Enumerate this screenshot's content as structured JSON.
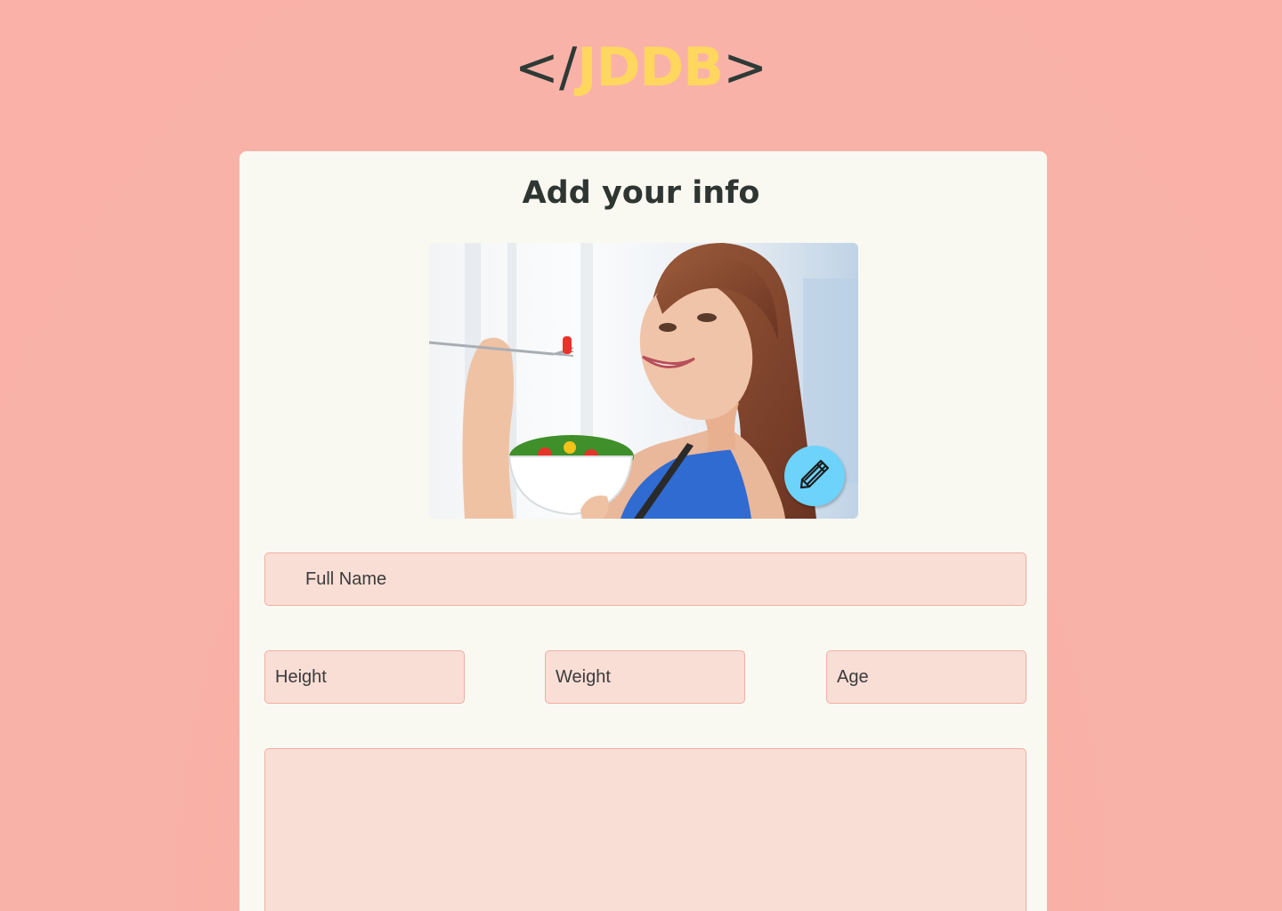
{
  "logo": {
    "open_bracket": "</",
    "brand": "JDDB",
    "close_bracket": ">",
    "colors": {
      "bracket": "#2e3a36",
      "brand": "#ffd75e"
    }
  },
  "form": {
    "title": "Add your info",
    "photo_alt": "Woman eating a salad",
    "edit_icon": "pencil-icon",
    "full_name": {
      "placeholder": "Full Name",
      "value": ""
    },
    "height": {
      "placeholder": "Height",
      "value": ""
    },
    "weight": {
      "placeholder": "Weight",
      "value": ""
    },
    "age": {
      "placeholder": "Age",
      "value": ""
    },
    "notes": {
      "placeholder": "",
      "value": ""
    }
  },
  "colors": {
    "background": "#f9b1a8",
    "card": "#f9f9f2",
    "field_fill": "#f9ded6",
    "field_border": "#f1aea3",
    "edit_button": "#6dd3fb",
    "title_text": "#2f3632"
  }
}
